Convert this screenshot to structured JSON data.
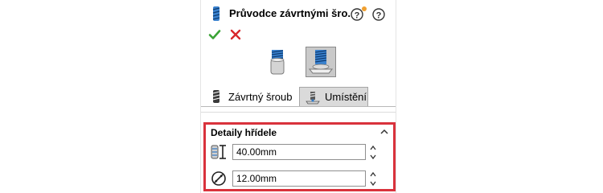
{
  "header": {
    "title": "Průvodce závrtnými šro...",
    "title_icon": "screw-icon",
    "help_icons": [
      "help-whats-new-icon",
      "help-icon"
    ]
  },
  "actions": {
    "ok_icon": "checkmark-icon",
    "cancel_icon": "close-icon"
  },
  "type_buttons": [
    {
      "icon": "stud-on-cylinder-icon",
      "selected": false
    },
    {
      "icon": "stud-on-surface-icon",
      "selected": true
    }
  ],
  "tabs": [
    {
      "label": "Závrtný šroub",
      "icon": "stud-icon",
      "active": true
    },
    {
      "label": "Umístění",
      "icon": "placement-icon",
      "active": false
    }
  ],
  "shaft_details": {
    "title": "Detaily hřídele",
    "length_value": "40.00mm",
    "diameter_value": "12.00mm"
  },
  "colors": {
    "highlight_border": "#d9323c",
    "ok_green": "#3aa335",
    "cancel_red": "#d8262b",
    "icon_blue": "#2f78c4"
  }
}
